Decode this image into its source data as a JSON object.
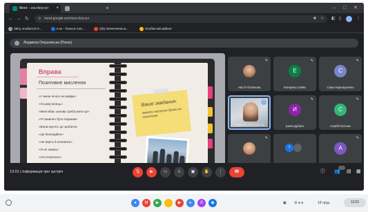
{
  "browser": {
    "tabs": [
      {
        "label": "Meet – uvu-fzxj-xcr",
        "active": true
      },
      {
        "label": "",
        "active": false
      }
    ],
    "new_tab_symbol": "+",
    "window_controls": {
      "minimize": "–",
      "maximize": "□",
      "close": "✕"
    },
    "url": "meet.google.com/uvu-fzxj-xcr",
    "bookmarks": [
      {
        "label": "Звіту особистої Н...",
        "color": "#9aa0a6"
      },
      {
        "label": "е-кз - Точка в Але...",
        "color": "#1a73e8"
      },
      {
        "label": "(25) Автентична м...",
        "color": "#ea4335"
      },
      {
        "label": "Особистий кабінет",
        "color": "#fbbc04"
      }
    ]
  },
  "meet": {
    "presenter_label": "Людмила Опушовська (Показ)",
    "slide": {
      "title": "Вправа",
      "subtitle": "Позитивне мислення",
      "bullets": [
        "«У мене нічого не вийде»",
        "«Усьому кінець»",
        "«Мені вбає занова треба жити це»",
        "«Я повинен бути першим»",
        "«Вони мусять це зробити»",
        "«Це безнадійно»",
        "«Не варто й починати»",
        "«Я не зможу»",
        "«Усе втрачено»"
      ],
      "note_title": "Ваше завдання:",
      "note_body": "змініти наступні думки на позитивні"
    },
    "participants": [
      {
        "name": "Настя Поляхова",
        "type": "photo",
        "initial": "",
        "color": ""
      },
      {
        "name": "Катерина Сайко",
        "type": "initial",
        "initial": "E",
        "color": "#0b8043"
      },
      {
        "name": "Саша Карнаушенко",
        "type": "initial",
        "initial": "C",
        "color": "#7986cb"
      },
      {
        "name": "Людмила Опушовська",
        "type": "video",
        "initial": "",
        "color": ""
      },
      {
        "name": "Ірина Дубага",
        "type": "initial",
        "initial": "И",
        "color": "#8e24aa"
      },
      {
        "name": "Сергій Котенко",
        "type": "initial",
        "initial": "C",
        "color": "#33b679"
      },
      {
        "name": "Даня Супрун",
        "type": "photo",
        "initial": "",
        "color": ""
      },
      {
        "name": "Ще 7 осіб",
        "type": "more",
        "initial": "",
        "color": ""
      },
      {
        "name": "Андрій сочник",
        "type": "initial",
        "initial": "A",
        "color": "#7e57c2"
      }
    ],
    "bottom": {
      "time": "13:01",
      "separator": "|",
      "meeting_info": "Інформація про зустріч",
      "more_count": "7"
    }
  },
  "taskbar": {
    "lang": "uk",
    "date": "18 груд.",
    "time": "13:01",
    "status": "UA ▼ ▮"
  },
  "colors": {
    "meet_bg": "#202124",
    "tile_bg": "#3c4043",
    "danger": "#ea4335",
    "accent": "#8ab4f8",
    "slide_title": "#d2527a",
    "sticky_note": "#f5dd78"
  }
}
